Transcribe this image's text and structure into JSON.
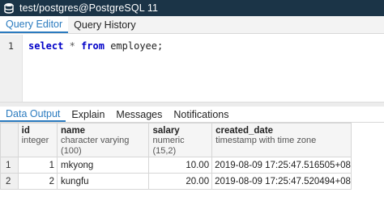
{
  "titlebar": {
    "title": "test/postgres@PostgreSQL 11",
    "icon": "database-icon"
  },
  "editor_tabs": [
    {
      "label": "Query Editor",
      "active": true
    },
    {
      "label": "Query History",
      "active": false
    }
  ],
  "editor": {
    "line_number": "1",
    "code_tokens": {
      "select": "select",
      "star": "*",
      "from": "from",
      "rest": "employee;"
    }
  },
  "result_tabs": [
    {
      "label": "Data Output",
      "active": true
    },
    {
      "label": "Explain",
      "active": false
    },
    {
      "label": "Messages",
      "active": false
    },
    {
      "label": "Notifications",
      "active": false
    }
  ],
  "grid": {
    "columns": [
      {
        "name": "id",
        "type": "integer"
      },
      {
        "name": "name",
        "type": "character varying (100)"
      },
      {
        "name": "salary",
        "type": "numeric (15,2)"
      },
      {
        "name": "created_date",
        "type": "timestamp with time zone"
      }
    ],
    "rows": [
      {
        "num": "1",
        "id": "1",
        "name": "mkyong",
        "salary": "10.00",
        "created_date": "2019-08-09 17:25:47.516505+08"
      },
      {
        "num": "2",
        "id": "2",
        "name": "kungfu",
        "salary": "20.00",
        "created_date": "2019-08-09 17:25:47.520494+08"
      }
    ]
  },
  "colors": {
    "titlebar_bg": "#1b3447",
    "accent": "#2b7bbf",
    "keyword": "#0000c8"
  }
}
